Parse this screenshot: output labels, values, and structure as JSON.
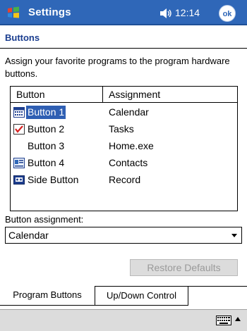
{
  "titlebar": {
    "title": "Settings",
    "time": "12:14",
    "ok_label": "ok"
  },
  "page": {
    "title": "Buttons",
    "instructions": "Assign your favorite programs to the program hardware buttons."
  },
  "list": {
    "columns": [
      "Button",
      "Assignment"
    ],
    "rows": [
      {
        "name": "Button 1",
        "assignment": "Calendar",
        "icon": "calendar-icon",
        "selected": true
      },
      {
        "name": "Button 2",
        "assignment": "Tasks",
        "icon": "tasks-icon",
        "selected": false
      },
      {
        "name": "Button 3",
        "assignment": "Home.exe",
        "icon": "",
        "selected": false
      },
      {
        "name": "Button 4",
        "assignment": "Contacts",
        "icon": "contacts-icon",
        "selected": false
      },
      {
        "name": "Side Button",
        "assignment": "Record",
        "icon": "record-icon",
        "selected": false
      }
    ]
  },
  "assignment": {
    "label": "Button assignment:",
    "value": "Calendar"
  },
  "restore_label": "Restore Defaults",
  "tabs": [
    {
      "label": "Program Buttons",
      "active": true
    },
    {
      "label": "Up/Down Control",
      "active": false
    }
  ],
  "colors": {
    "titlebar": "#2f67b8",
    "selection": "#2f5fb3",
    "heading": "#1a3d8f"
  }
}
